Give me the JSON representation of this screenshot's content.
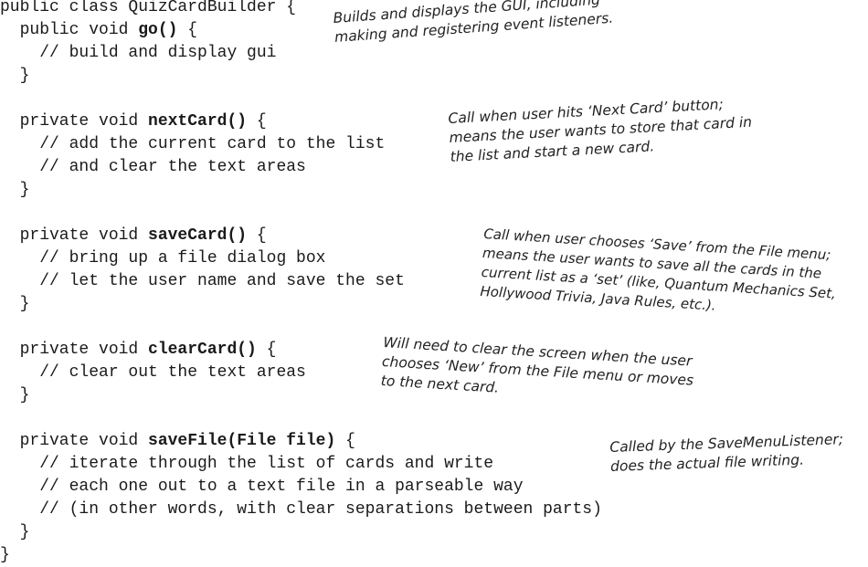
{
  "code_lines": [
    {
      "pre": "public class QuizCardBuilder {",
      "bold": "",
      "post": ""
    },
    {
      "pre": "  public void ",
      "bold": "go()",
      "post": " {"
    },
    {
      "pre": "    // build and display gui",
      "bold": "",
      "post": ""
    },
    {
      "pre": "  }",
      "bold": "",
      "post": ""
    },
    {
      "pre": "",
      "bold": "",
      "post": ""
    },
    {
      "pre": "  private void ",
      "bold": "nextCard()",
      "post": " {"
    },
    {
      "pre": "    // add the current card to the list",
      "bold": "",
      "post": ""
    },
    {
      "pre": "    // and clear the text areas",
      "bold": "",
      "post": ""
    },
    {
      "pre": "  }",
      "bold": "",
      "post": ""
    },
    {
      "pre": "",
      "bold": "",
      "post": ""
    },
    {
      "pre": "  private void ",
      "bold": "saveCard()",
      "post": " {"
    },
    {
      "pre": "    // bring up a file dialog box",
      "bold": "",
      "post": ""
    },
    {
      "pre": "    // let the user name and save the set",
      "bold": "",
      "post": ""
    },
    {
      "pre": "  }",
      "bold": "",
      "post": ""
    },
    {
      "pre": "",
      "bold": "",
      "post": ""
    },
    {
      "pre": "  private void ",
      "bold": "clearCard()",
      "post": " {"
    },
    {
      "pre": "    // clear out the text areas",
      "bold": "",
      "post": ""
    },
    {
      "pre": "  }",
      "bold": "",
      "post": ""
    },
    {
      "pre": "",
      "bold": "",
      "post": ""
    },
    {
      "pre": "  private void ",
      "bold": "saveFile(File file)",
      "post": " {"
    },
    {
      "pre": "    // iterate through the list of cards and write",
      "bold": "",
      "post": ""
    },
    {
      "pre": "    // each one out to a text file in a parseable way",
      "bold": "",
      "post": ""
    },
    {
      "pre": "    // (in other words, with clear separations between parts)",
      "bold": "",
      "post": ""
    },
    {
      "pre": "  }",
      "bold": "",
      "post": ""
    },
    {
      "pre": "}",
      "bold": "",
      "post": ""
    }
  ],
  "annotations": {
    "go": {
      "line1": "Builds and displays the GUI, including",
      "line2": "making and registering event listeners."
    },
    "next_card": {
      "line1": "Call when user hits ‘Next Card’ button;",
      "line2": "means the user wants to store that card in",
      "line3": "the list and start a  new card."
    },
    "save_card": {
      "line1": "Call when user chooses ‘Save’ from the File menu;",
      "line2": "means the user wants to save all the cards in the",
      "line3": "current list as a ‘set’ (like, Quantum Mechanics Set,",
      "line4": "Hollywood Trivia, Java Rules, etc.)."
    },
    "clear_card": {
      "line1": "Will need to clear the screen when the user",
      "line2": "chooses ‘New’ from the File menu or moves",
      "line3": "to the next card."
    },
    "save_file": {
      "line1": "Called by the SaveMenuListener;",
      "line2": "does the actual file writing."
    }
  }
}
